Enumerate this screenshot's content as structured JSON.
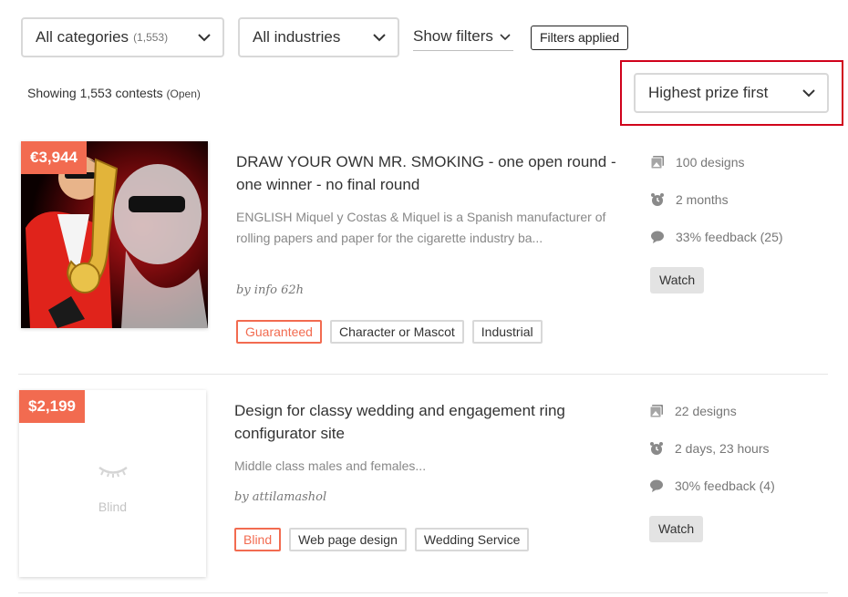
{
  "toolbar": {
    "category_label": "All categories",
    "category_count": "(1,553)",
    "industry_label": "All industries",
    "show_filters_label": "Show filters",
    "filters_applied_label": "Filters applied"
  },
  "summary": {
    "showing_text": "Showing 1,553 contests",
    "status_text": "(Open)"
  },
  "sort": {
    "selected": "Highest prize first"
  },
  "colors": {
    "accent": "#f26b50",
    "highlight": "#d0021b"
  },
  "contests": [
    {
      "prize": "€3,944",
      "title": "DRAW YOUR OWN MR. SMOKING - one open round - one winner - no final round",
      "description": "ENGLISH Miquel y Costas & Miquel is a Spanish manufacturer of rolling papers and paper for the cigarette industry ba...",
      "byline": "by info 62h",
      "tags": [
        "Guaranteed",
        "Character or Mascot",
        "Industrial"
      ],
      "designs": "100 designs",
      "time_left": "2 months",
      "feedback": "33% feedback (25)",
      "watch_label": "Watch",
      "thumbnail": "saxophone-mascot-illustration"
    },
    {
      "prize": "$2,199",
      "title": "Design for classy wedding and engagement ring configurator site",
      "description": "Middle class males and females...",
      "byline": "by attilamashol",
      "tags": [
        "Blind",
        "Web page design",
        "Wedding Service"
      ],
      "designs": "22 designs",
      "time_left": "2 days, 23 hours",
      "feedback": "30% feedback (4)",
      "watch_label": "Watch",
      "blind_label": "Blind"
    }
  ]
}
